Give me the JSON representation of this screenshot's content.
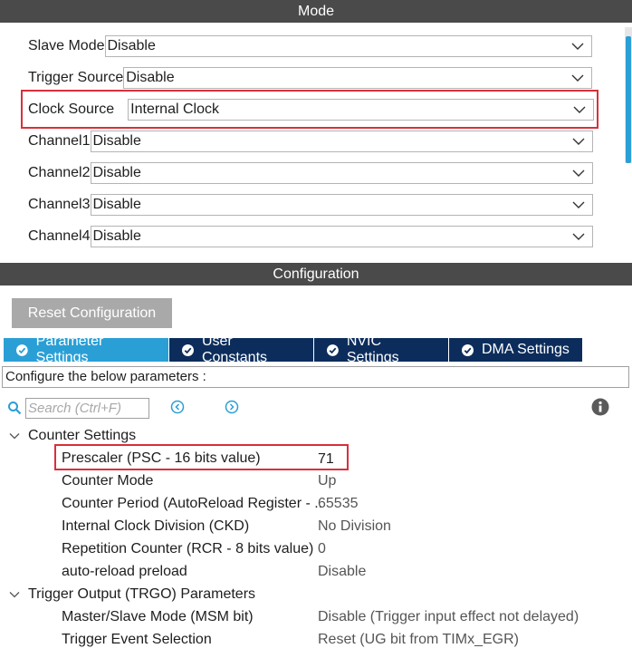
{
  "mode": {
    "header": "Mode",
    "rows": [
      {
        "label": "Slave Mode",
        "value": "Disable"
      },
      {
        "label": "Trigger Source",
        "value": "Disable"
      },
      {
        "label": "Clock Source",
        "value": "Internal Clock"
      },
      {
        "label": "Channel1",
        "value": "Disable"
      },
      {
        "label": "Channel2",
        "value": "Disable"
      },
      {
        "label": "Channel3",
        "value": "Disable"
      },
      {
        "label": "Channel4",
        "value": "Disable"
      }
    ]
  },
  "configuration": {
    "header": "Configuration",
    "reset_label": "Reset Configuration",
    "tabs": [
      {
        "label": "Parameter Settings",
        "active": true
      },
      {
        "label": "User Constants",
        "active": false
      },
      {
        "label": "NVIC Settings",
        "active": false
      },
      {
        "label": "DMA Settings",
        "active": false
      }
    ],
    "caption": "Configure the below parameters :",
    "search_placeholder": "Search (Ctrl+F)",
    "groups": [
      {
        "title": "Counter Settings",
        "params": [
          {
            "name": "Prescaler (PSC - 16 bits value)",
            "value": "71"
          },
          {
            "name": "Counter Mode",
            "value": "Up"
          },
          {
            "name": "Counter Period (AutoReload Register - ..",
            "value": "65535"
          },
          {
            "name": "Internal Clock Division (CKD)",
            "value": "No Division"
          },
          {
            "name": "Repetition Counter (RCR - 8 bits value)",
            "value": "0"
          },
          {
            "name": "auto-reload preload",
            "value": "Disable"
          }
        ]
      },
      {
        "title": "Trigger Output (TRGO) Parameters",
        "params": [
          {
            "name": "Master/Slave Mode (MSM bit)",
            "value": "Disable (Trigger input effect not delayed)"
          },
          {
            "name": "Trigger Event Selection",
            "value": "Reset (UG bit from TIMx_EGR)"
          }
        ]
      }
    ]
  },
  "colors": {
    "header_bg": "#4a4a4a",
    "tab_active": "#2a9fd6",
    "tab_inactive": "#0c2d5c",
    "highlight": "#d8303b"
  }
}
